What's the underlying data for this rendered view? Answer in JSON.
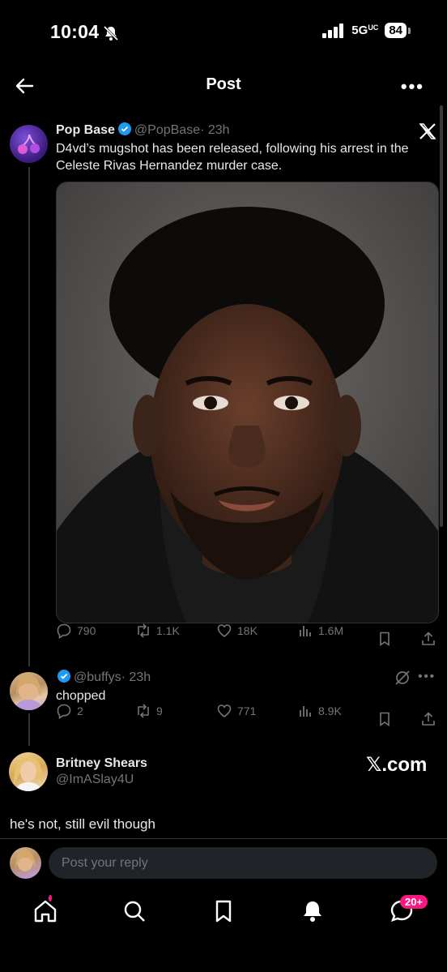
{
  "status_bar": {
    "time": "10:04",
    "network": "5G",
    "network_sup": "UC",
    "battery": "84"
  },
  "header": {
    "title": "Post"
  },
  "tweet": {
    "name": "Pop Base",
    "handle": "@PopBase",
    "time": "· 23h",
    "text": "D4vd’s mugshot has been released, following his arrest in the Celeste Rivas Hernandez murder case.",
    "stats": {
      "replies": "790",
      "reposts": "1.1K",
      "likes": "18K",
      "views": "1.6M"
    }
  },
  "reply": {
    "handle": "@buffys",
    "time": "· 23h",
    "text": "chopped",
    "stats": {
      "replies": "2",
      "reposts": "9",
      "likes": "771",
      "views": "8.9K"
    }
  },
  "quote_card": {
    "name": "Britney Shears",
    "handle": "@ImASlay4U",
    "watermark": "𝕏.com",
    "text": "he's not, still evil though"
  },
  "composer": {
    "placeholder": "Post your reply"
  },
  "nav": {
    "messages_badge": "20+"
  },
  "colors": {
    "accent": "#1d9bf0",
    "background": "#000000",
    "muted": "#71767b",
    "badge": "#f91880"
  }
}
